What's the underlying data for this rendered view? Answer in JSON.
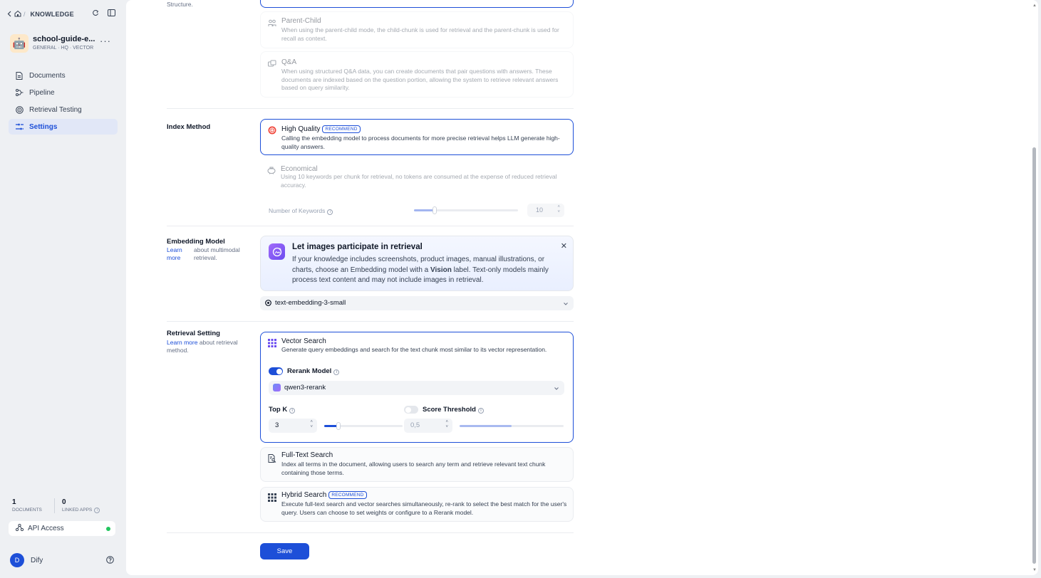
{
  "breadcrumb": {
    "section": "KNOWLEDGE"
  },
  "dataset": {
    "name": "school-guide-e...",
    "tags": "GENERAL · HQ · VECTOR",
    "avatar": "🤖"
  },
  "nav": [
    {
      "label": "Documents",
      "icon": "document-icon"
    },
    {
      "label": "Pipeline",
      "icon": "pipeline-icon"
    },
    {
      "label": "Retrieval Testing",
      "icon": "target-icon"
    },
    {
      "label": "Settings",
      "icon": "settings-icon",
      "active": true
    }
  ],
  "stats": {
    "documents_count": "1",
    "documents_label": "DOCUMENTS",
    "linked_apps_count": "0",
    "linked_apps_label": "LINKED APPS"
  },
  "api": {
    "label": "API Access",
    "status_color": "#22c55e"
  },
  "user": {
    "initial": "D",
    "name": "Dify"
  },
  "chunk_structure": {
    "label_fragment": "Structure.",
    "options": [
      {
        "title": "Parent-Child",
        "desc": "When using the parent-child mode, the child-chunk is used for retrieval and the parent-chunk is used for recall as context."
      },
      {
        "title": "Q&A",
        "desc": "When using structured Q&A data, you can create documents that pair questions with answers. These documents are indexed based on the question portion, allowing the system to retrieve relevant answers based on query similarity."
      }
    ]
  },
  "index_method": {
    "label": "Index Method",
    "high_quality": {
      "title": "High Quality",
      "badge": "RECOMMEND",
      "desc": "Calling the embedding model to process documents for more precise retrieval helps LLM generate high-quality answers.",
      "selected": true
    },
    "economical": {
      "title": "Economical",
      "desc": "Using 10 keywords per chunk for retrieval, no tokens are consumed at the expense of reduced retrieval accuracy."
    },
    "keywords": {
      "label": "Number of Keywords",
      "value": "10",
      "slider_fraction": 0.2
    }
  },
  "embedding": {
    "label": "Embedding Model",
    "learn_more": "Learn more",
    "sub": "about multimodal retrieval.",
    "banner": {
      "title": "Let images participate in retrieval",
      "desc_pre": "If your knowledge includes screenshots, product images, manual illustrations, or charts, choose an Embedding model with a ",
      "desc_bold": "Vision",
      "desc_post": " label. Text-only models mainly process text content and may not include images in retrieval."
    },
    "model": "text-embedding-3-small"
  },
  "retrieval": {
    "label": "Retrieval Setting",
    "learn_more": "Learn more",
    "sub": " about retrieval method.",
    "vector": {
      "title": "Vector Search",
      "desc": "Generate query embeddings and search for the text chunk most similar to its vector representation."
    },
    "rerank": {
      "label": "Rerank Model",
      "enabled": true,
      "model": "qwen3-rerank"
    },
    "top_k": {
      "label": "Top K",
      "value": "3",
      "slider_fraction": 0.18
    },
    "score_threshold": {
      "label": "Score Threshold",
      "enabled": false,
      "value": "0,5",
      "slider_fraction": 0.5
    },
    "full_text": {
      "title": "Full-Text Search",
      "desc": "Index all terms in the document, allowing users to search any term and retrieve relevant text chunk containing those terms."
    },
    "hybrid": {
      "title": "Hybrid Search",
      "badge": "RECOMMEND",
      "desc": "Execute full-text search and vector searches simultaneously, re-rank to select the best match for the user's query. Users can choose to set weights or configure to a Rerank model."
    }
  },
  "save_label": "Save",
  "colors": {
    "accent": "#1d4fd8",
    "sidebar_bg": "#eef0f3",
    "active_nav_bg": "#e1e7f7"
  }
}
